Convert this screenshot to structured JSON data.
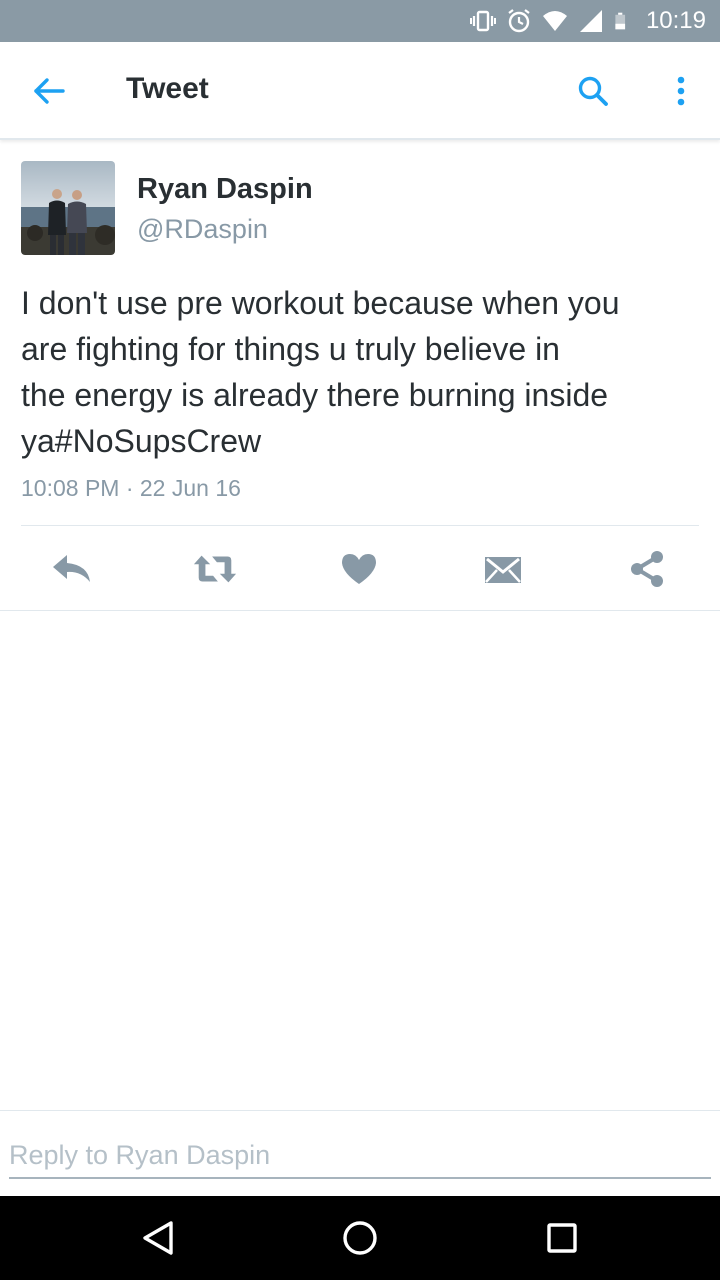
{
  "status_bar": {
    "time": "10:19",
    "icons": [
      "vibrate-icon",
      "alarm-icon",
      "wifi-icon",
      "cellular-signal-icon",
      "battery-icon"
    ]
  },
  "app_bar": {
    "title": "Tweet",
    "back_icon": "arrow-left-icon",
    "search_icon": "search-icon",
    "more_icon": "more-vertical-icon"
  },
  "tweet": {
    "author_name": "Ryan Daspin",
    "author_handle": "@RDaspin",
    "text": "I don't use pre workout because when you\nare fighting for things u truly believe in\nthe energy is already there burning inside\nya#NoSupsCrew",
    "timestamp": "10:08 PM · 22 Jun 16"
  },
  "actions": [
    {
      "name": "reply",
      "icon": "reply-icon"
    },
    {
      "name": "retweet",
      "icon": "retweet-icon"
    },
    {
      "name": "like",
      "icon": "heart-icon"
    },
    {
      "name": "direct-message",
      "icon": "envelope-icon"
    },
    {
      "name": "share",
      "icon": "share-icon"
    }
  ],
  "reply": {
    "placeholder": "Reply to Ryan Daspin",
    "value": ""
  },
  "nav_bar": {
    "icons": [
      "back-triangle-icon",
      "home-circle-icon",
      "recents-square-icon"
    ]
  },
  "colors": {
    "accent": "#1da1f2",
    "status_bar": "#8a9aa5",
    "action_gray": "#8899a6",
    "text_primary": "#292f33"
  }
}
